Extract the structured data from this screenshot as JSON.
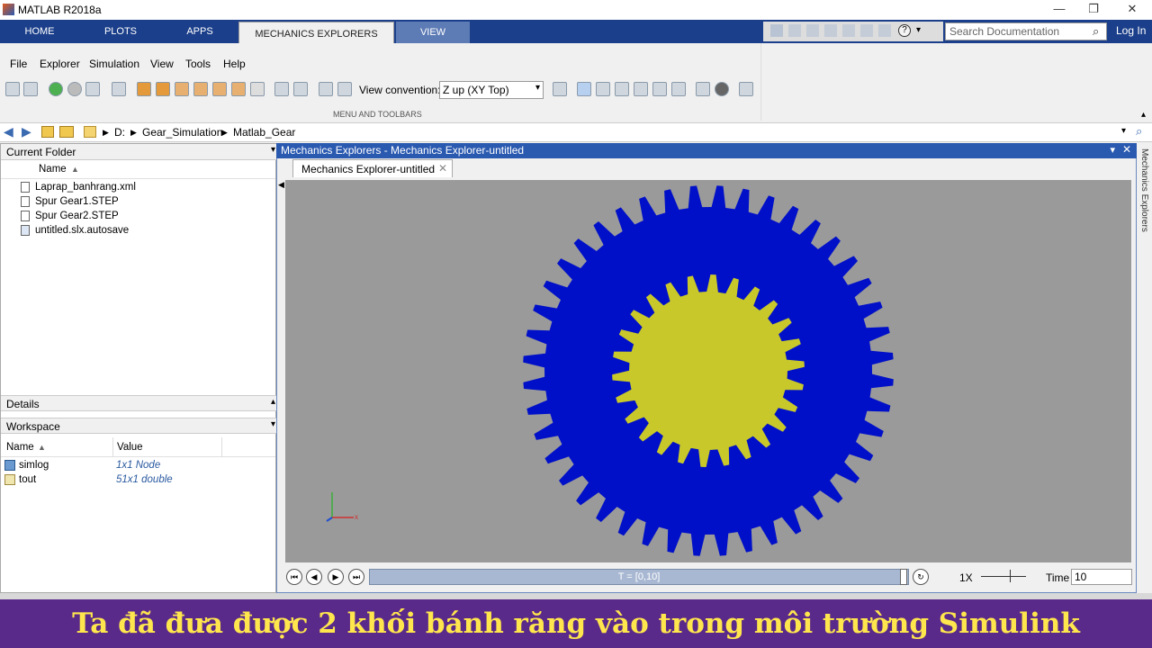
{
  "window": {
    "title": "MATLAB R2018a"
  },
  "ribbon": {
    "tabs": [
      "HOME",
      "PLOTS",
      "APPS",
      "MECHANICS EXPLORERS",
      "VIEW"
    ],
    "search_placeholder": "Search Documentation",
    "login": "Log In",
    "group_label": "MENU AND TOOLBARS"
  },
  "menu": {
    "items": [
      "File",
      "Explorer",
      "Simulation",
      "View",
      "Tools",
      "Help"
    ]
  },
  "toolbar": {
    "view_convention_label": "View convention:",
    "view_convention_value": "Z up (XY Top)"
  },
  "address": {
    "path": [
      "D:",
      "Gear_Simulation",
      "Matlab_Gear"
    ]
  },
  "current_folder": {
    "title": "Current Folder",
    "column": "Name",
    "files": [
      "Laprap_banhrang.xml",
      "Spur Gear1.STEP",
      "Spur Gear2.STEP",
      "untitled.slx.autosave"
    ]
  },
  "details": {
    "title": "Details"
  },
  "workspace": {
    "title": "Workspace",
    "columns": [
      "Name",
      "Value"
    ],
    "rows": [
      {
        "name": "simlog",
        "value": "1x1 Node"
      },
      {
        "name": "tout",
        "value": "51x1 double"
      }
    ]
  },
  "mechanics": {
    "window_title": "Mechanics Explorers - Mechanics Explorer-untitled",
    "tab_label": "Mechanics Explorer-untitled",
    "timeline_label": "T = [0,10]",
    "speed": "1X",
    "time_label": "Time",
    "time_value": "10",
    "side_label": "Mechanics Explorers",
    "canvas_bg": "#9a9a9a",
    "outer_gear_color": "#0010c8",
    "inner_gear_color": "#c8c82a",
    "axis_x_label": "x"
  },
  "caption": {
    "text": "Ta đã đưa được 2 khối bánh răng vào trong môi trường Simulink"
  }
}
